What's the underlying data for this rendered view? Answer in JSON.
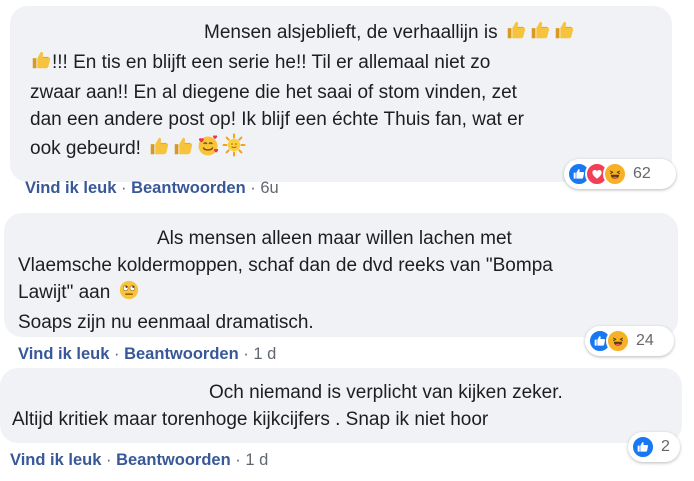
{
  "comments": [
    {
      "lines": [
        "Mensen alsjeblieft, de verhaallijn is",
        "!!! En tis en blijft een serie he!! Til er allemaal niet zo",
        "zwaar aan!! En al diegene die het saai of stom vinden, zet",
        "dan een andere post op! Ik blijf een échte Thuis fan, wat er",
        "ook gebeurd!"
      ],
      "like_label": "Vind ik leuk",
      "separator": "·",
      "reply_label": "Beantwoorden",
      "time": "6u",
      "reactions": [
        "like-icon",
        "love-icon",
        "haha-icon"
      ],
      "reaction_count": "62"
    },
    {
      "lines": [
        "Als mensen alleen maar willen lachen met",
        "Vlaemsche koldermoppen, schaf dan de dvd reeks van \"Bompa",
        "Lawijt\" aan",
        "Soaps zijn nu eenmaal dramatisch."
      ],
      "like_label": "Vind ik leuk",
      "separator": "·",
      "reply_label": "Beantwoorden",
      "time": "1 d",
      "reactions": [
        "like-icon",
        "haha-icon"
      ],
      "reaction_count": "24"
    },
    {
      "lines": [
        "Och niemand is verplicht van kijken zeker.",
        "Altijd kritiek maar torenhoge kijkcijfers . Snap ik niet hoor"
      ],
      "like_label": "Vind ik leuk",
      "separator": "·",
      "reply_label": "Beantwoorden",
      "time": "1 d",
      "reactions": [
        "like-icon"
      ],
      "reaction_count": "2"
    }
  ],
  "colors": {
    "bubble": "#f0f2f5",
    "link": "#385898",
    "meta": "#606770",
    "like": "#1877f2",
    "love": "#f33e58",
    "haha": "#f7b125",
    "thumbs_emoji": "#f5b935"
  }
}
